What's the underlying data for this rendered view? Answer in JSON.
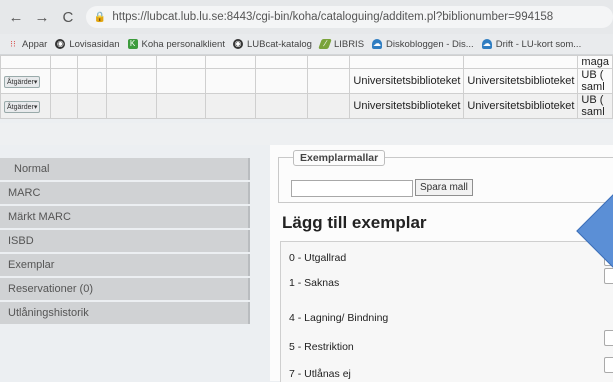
{
  "browser": {
    "url": "https://lubcat.lub.lu.se:8443/cgi-bin/koha/cataloguing/additem.pl?biblionumber=994158",
    "bookmarks": [
      {
        "label": "Appar",
        "icon": "apps-grid-icon",
        "color": "#d9534f"
      },
      {
        "label": "Lovisasidan",
        "icon": "globe-icon",
        "color": "#333333"
      },
      {
        "label": "Koha personalklient",
        "icon": "koha-icon",
        "color": "#3c9b3c"
      },
      {
        "label": "LUBcat-katalog",
        "icon": "globe-icon",
        "color": "#333333"
      },
      {
        "label": "LIBRIS",
        "icon": "libris-icon",
        "color": "#7aa33a"
      },
      {
        "label": "Diskobloggen - Dis...",
        "icon": "cloud-icon",
        "color": "#2f7dc1"
      },
      {
        "label": "Drift - LU-kort som...",
        "icon": "cloud-icon",
        "color": "#2f7dc1"
      }
    ]
  },
  "items_table": {
    "stub_text": "maga",
    "rows": [
      {
        "action": "Åtgärder▾",
        "home": "Universitetsbiblioteket",
        "holding": "Universitetsbiblioteket",
        "location": "UB (",
        "location2": "saml"
      },
      {
        "action": "Åtgärder▾",
        "home": "Universitetsbiblioteket",
        "holding": "Universitetsbiblioteket",
        "location": "UB (",
        "location2": "saml"
      }
    ]
  },
  "view_tabs": [
    {
      "label": "Normal"
    },
    {
      "label": "MARC"
    },
    {
      "label": "Märkt MARC"
    },
    {
      "label": "ISBD"
    },
    {
      "label": "Exemplar"
    },
    {
      "label": "Reservationer (0)"
    },
    {
      "label": "Utlåningshistorik"
    }
  ],
  "templates": {
    "legend": "Exemplarmallar",
    "save_button": "Spara mall"
  },
  "page_title": "Lägg till exemplar",
  "fields": [
    {
      "label": "0 - Utgallrad"
    },
    {
      "label": "1 - Saknas"
    },
    {
      "label": "4 - Lagning/ Bindning"
    },
    {
      "label": "5 - Restriktion"
    },
    {
      "label": "7 - Utlånas ej"
    }
  ]
}
